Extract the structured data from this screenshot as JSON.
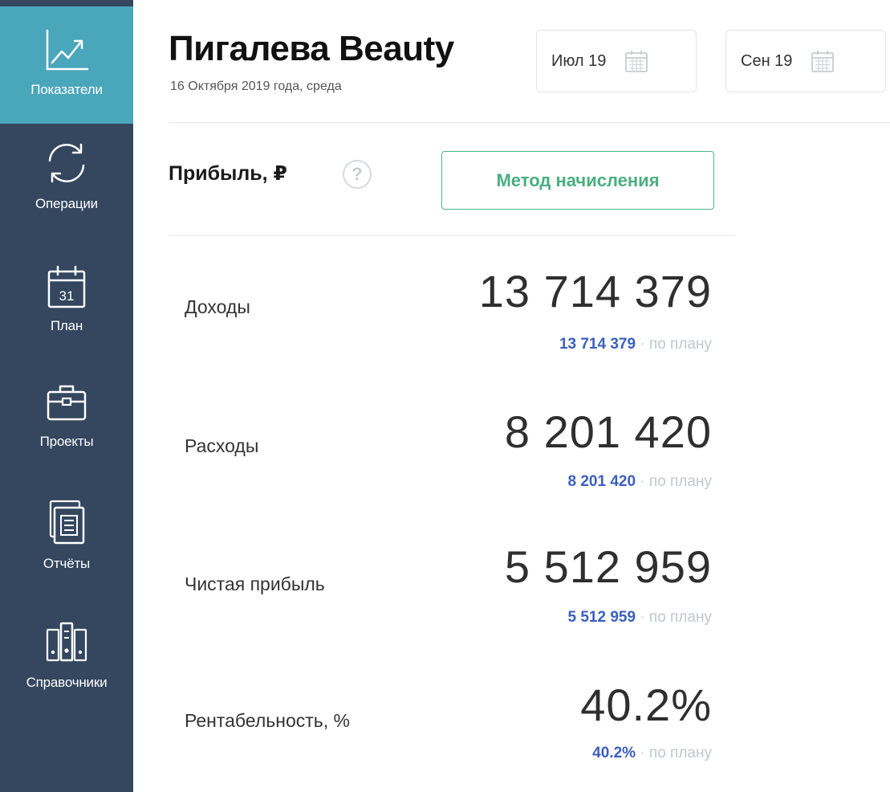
{
  "sidebar": {
    "items": [
      {
        "label": "Показатели",
        "icon": "chart-line-icon",
        "active": true
      },
      {
        "label": "Операции",
        "icon": "sync-icon",
        "active": false
      },
      {
        "label": "План",
        "icon": "calendar-icon",
        "calendar_day": "31",
        "active": false
      },
      {
        "label": "Проекты",
        "icon": "briefcase-icon",
        "active": false
      },
      {
        "label": "Отчёты",
        "icon": "reports-icon",
        "active": false
      },
      {
        "label": "Справочники",
        "icon": "directory-icon",
        "active": false
      }
    ],
    "colors": {
      "background": "#34475f",
      "active": "#4aa6bb"
    }
  },
  "header": {
    "title": "Пигалева Beauty",
    "subtitle": "16 Октября 2019 года, среда",
    "date_from": "Июл 19",
    "date_to": "Сен 19"
  },
  "profit": {
    "title": "Прибыль, ₽",
    "help": "?",
    "method_button": "Метод начисления",
    "plan_suffix": "по плану",
    "plan_separator": "·",
    "metrics": [
      {
        "label": "Доходы",
        "value": "13 714 379",
        "plan": "13 714 379"
      },
      {
        "label": "Расходы",
        "value": "8 201 420",
        "plan": "8 201 420"
      },
      {
        "label": "Чистая прибыль",
        "value": "5 512 959",
        "plan": "5 512 959"
      },
      {
        "label": "Рентабельность, %",
        "value": "40.2%",
        "plan": "40.2%"
      }
    ]
  },
  "colors": {
    "accent_green": "#4cb685",
    "plan_blue": "#3b5fc0"
  }
}
